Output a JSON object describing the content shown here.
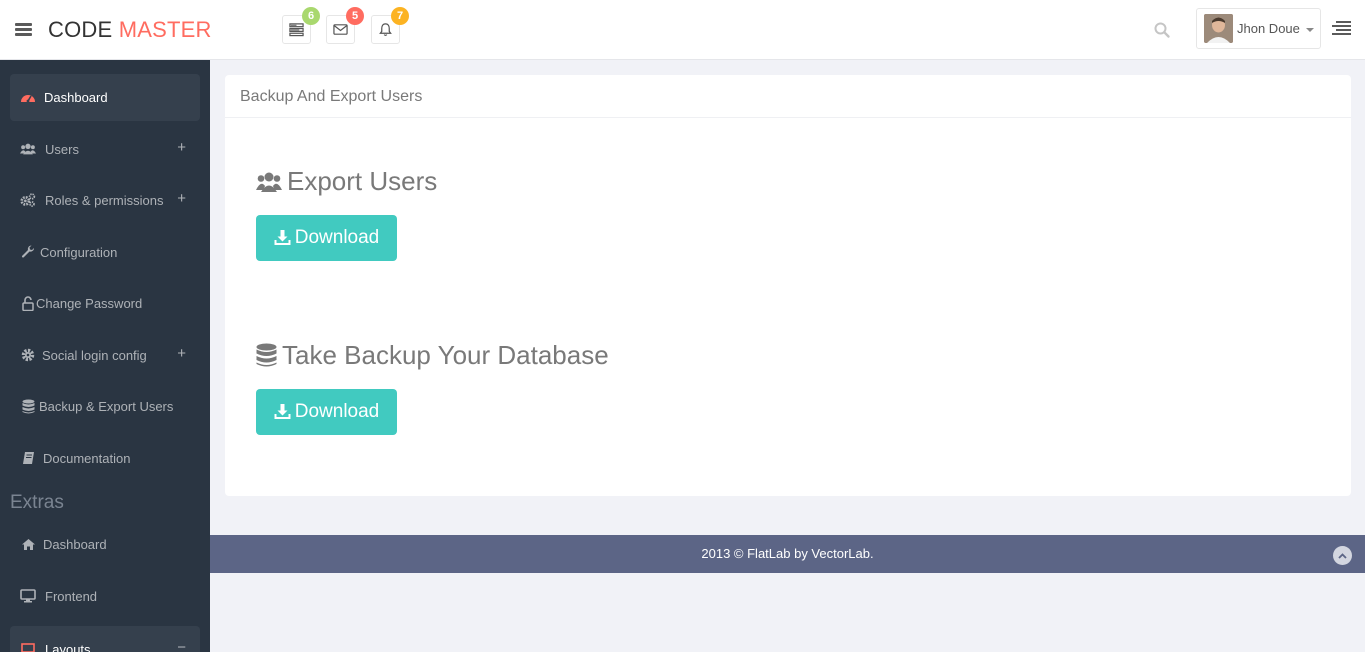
{
  "brand": {
    "part1": "CODE ",
    "part2": "MASTER"
  },
  "header": {
    "notifications": [
      {
        "icon": "tasks-icon",
        "count": "6",
        "color": "#a9d86e"
      },
      {
        "icon": "envelope-icon",
        "count": "5",
        "color": "#ff6c60"
      },
      {
        "icon": "bell-icon",
        "count": "7",
        "color": "#fcb322"
      }
    ],
    "user_name": "Jhon Doue"
  },
  "sidebar": {
    "items": [
      {
        "label": "Dashboard",
        "icon": "dashboard-icon",
        "active": true
      },
      {
        "label": "Users",
        "icon": "users-icon",
        "expand": "+"
      },
      {
        "label": "Roles & permissions",
        "icon": "cogs-icon",
        "expand": "+"
      },
      {
        "label": "Configuration",
        "icon": "wrench-icon"
      },
      {
        "label": "Change Password",
        "icon": "unlock-icon"
      },
      {
        "label": "Social login config",
        "icon": "gear-icon",
        "expand": "+"
      },
      {
        "label": "Backup & Export Users",
        "icon": "database-icon"
      },
      {
        "label": "Documentation",
        "icon": "book-icon"
      }
    ],
    "extras_heading": "Extras",
    "extras": [
      {
        "label": "Dashboard",
        "icon": "home-icon"
      },
      {
        "label": "Frontend",
        "icon": "desktop-icon"
      },
      {
        "label": "Layouts",
        "icon": "laptop-icon",
        "expand": "−"
      }
    ]
  },
  "panel": {
    "title": "Backup And Export Users",
    "sections": [
      {
        "title": "Export Users",
        "icon": "users-icon",
        "button": "Download"
      },
      {
        "title": "Take Backup Your Database",
        "icon": "database-icon",
        "button": "Download"
      }
    ]
  },
  "footer": {
    "text": "2013 © FlatLab by VectorLab."
  },
  "colors": {
    "accent": "#ff6c60",
    "button": "#41cac0",
    "sidebar": "#2a3542",
    "footer": "#5c6586"
  }
}
